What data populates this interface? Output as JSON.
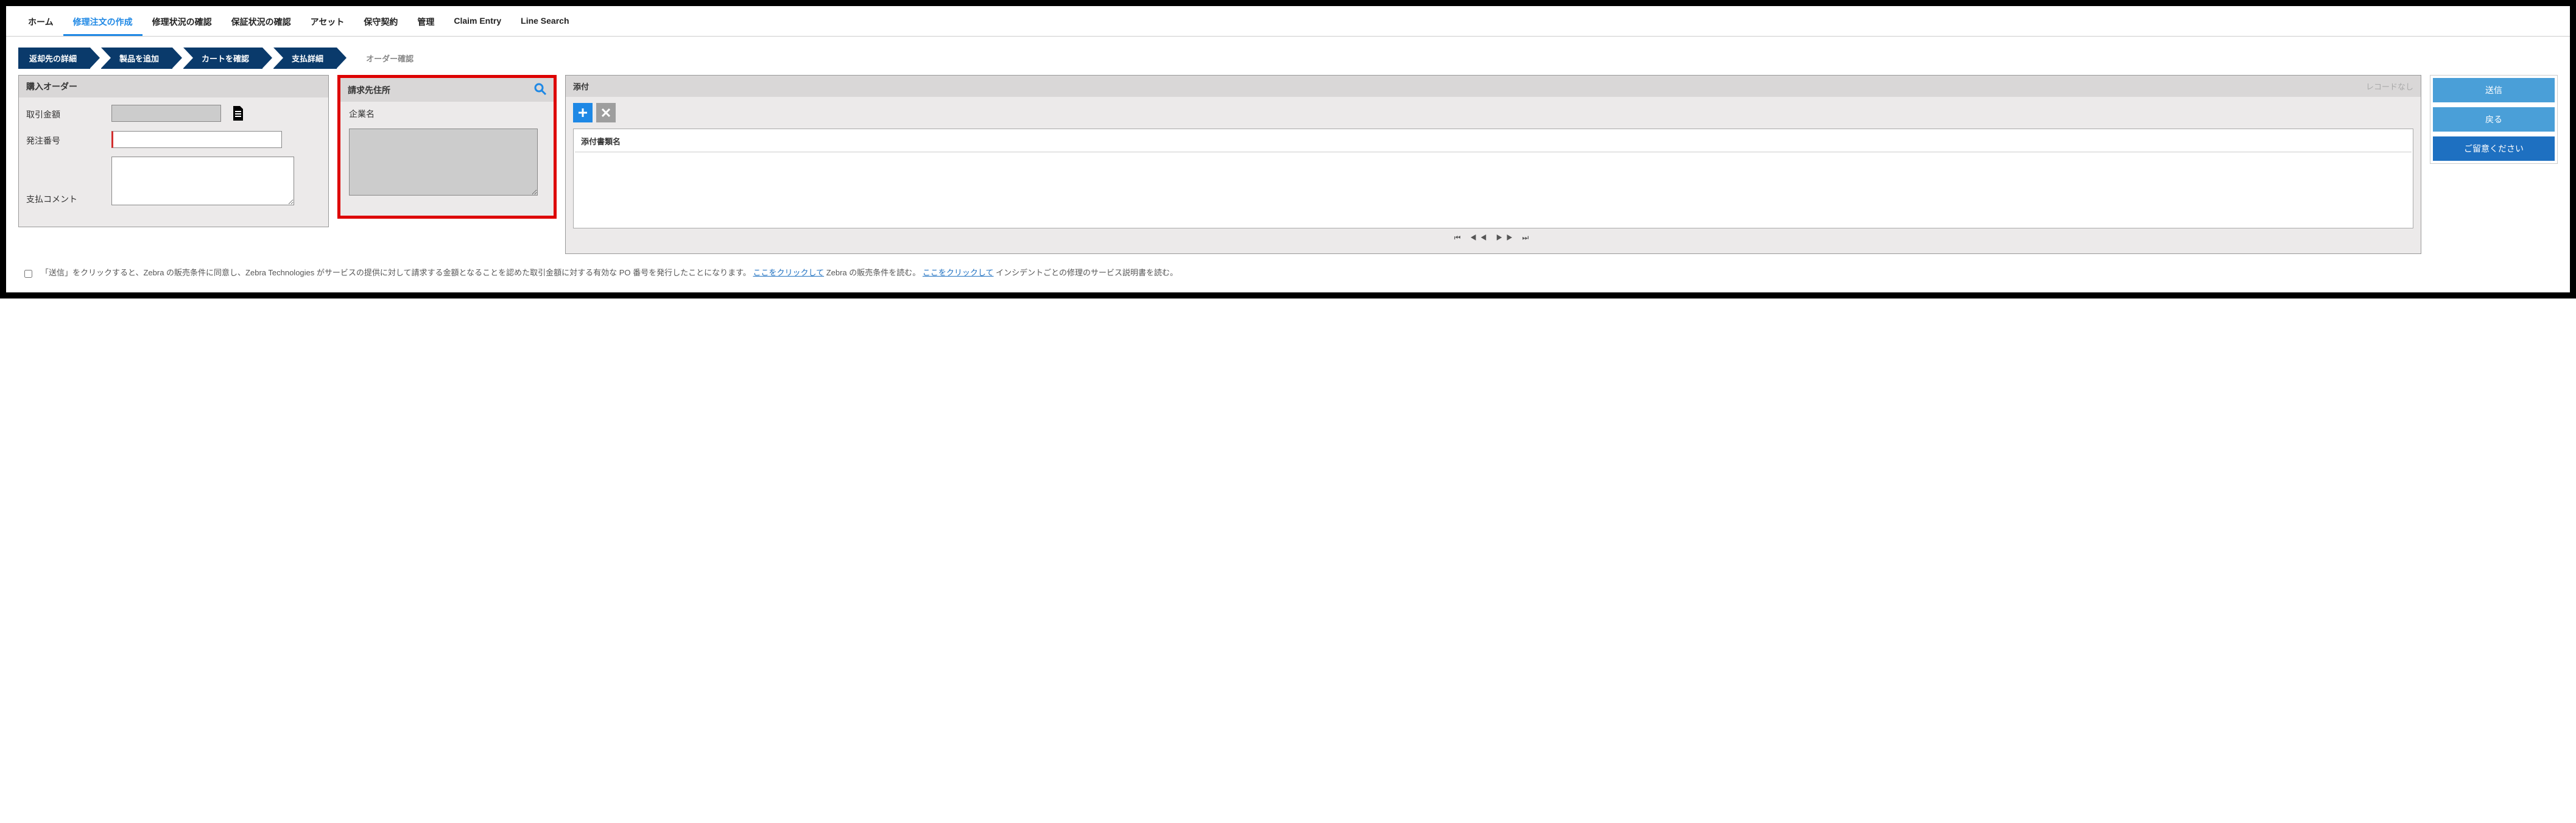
{
  "nav": {
    "items": [
      "ホーム",
      "修理注文の作成",
      "修理状況の確認",
      "保証状況の確認",
      "アセット",
      "保守契約",
      "管理",
      "Claim Entry",
      "Line Search"
    ],
    "active_index": 1
  },
  "steps": {
    "items": [
      "返却先の詳細",
      "製品を追加",
      "カートを確認",
      "支払詳細",
      "オーダー確認"
    ],
    "inactive_index": 4
  },
  "purchase_order": {
    "title": "購入オーダー",
    "amount_label": "取引金額",
    "amount_value": "",
    "po_label": "発注番号",
    "po_value": "",
    "comment_label": "支払コメント",
    "comment_value": ""
  },
  "billing": {
    "title": "請求先住所",
    "company_label": "企業名",
    "address_value": ""
  },
  "attachments": {
    "title": "添付",
    "no_records": "レコードなし",
    "column_header": "添付書類名"
  },
  "actions": {
    "submit": "送信",
    "back": "戻る",
    "note": "ご留意ください"
  },
  "terms": {
    "text1": "「送信」をクリックすると、Zebra の販売条件に同意し、Zebra Technologies がサービスの提供に対して請求する金額となることを認めた取引金額に対する有効な PO 番号を発行したことになります。",
    "link1": "ここをクリックして",
    "text2": " Zebra の販売条件を読む。",
    "link2": "ここをクリックして",
    "text3": " インシデントごとの修理のサービス説明書を読む。"
  }
}
